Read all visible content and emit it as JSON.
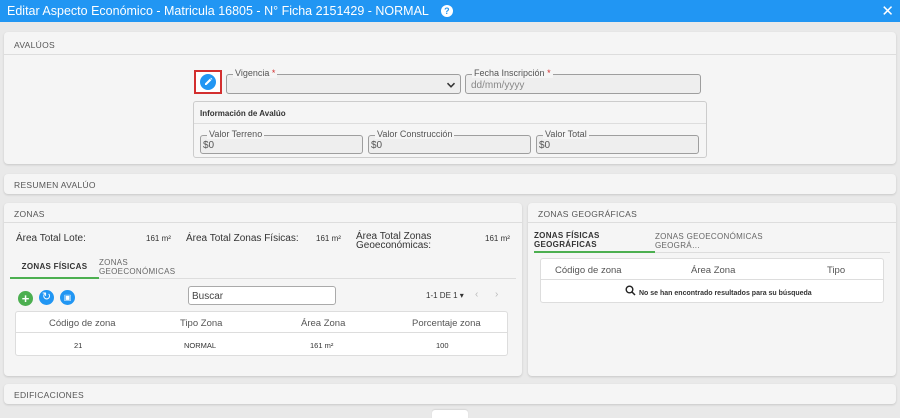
{
  "window": {
    "title": "Editar Aspecto Económico - Matricula 16805 - N° Ficha 2151429 - NORMAL",
    "help_icon": "question-circle-icon",
    "help_glyph": "?",
    "close_icon": "close-icon",
    "close_glyph": "✕"
  },
  "avaluos": {
    "section_title": "AVALÚOS",
    "edit_icon": "pencil-icon",
    "vigencia": {
      "label": "Vigencia",
      "required_mark": "*",
      "value": ""
    },
    "fecha_inscripcion": {
      "label": "Fecha Inscripción",
      "required_mark": "*",
      "placeholder": "dd/mm/yyyy"
    },
    "info": {
      "title": "Información de Avalúo",
      "valor_terreno": {
        "label": "Valor Terreno",
        "value": "$0"
      },
      "valor_construccion": {
        "label": "Valor Construcción",
        "value": "$0"
      },
      "valor_total": {
        "label": "Valor Total",
        "value": "$0"
      }
    }
  },
  "resumen": {
    "section_title": "RESUMEN AVALÚO"
  },
  "zonas": {
    "section_title": "ZONAS",
    "area_total_lote": {
      "label": "Área Total Lote:",
      "value": "161 m²"
    },
    "area_zonas_fisicas": {
      "label": "Área Total Zonas Físicas:",
      "value": "161 m²"
    },
    "area_zonas_geo": {
      "label_line1": "Área Total Zonas",
      "label_line2": "Geoeconómicas:",
      "value": "161 m²"
    },
    "tabs": [
      "ZONAS FÍSICAS",
      "ZONAS GEOECONÓMICAS"
    ],
    "add_glyph": "+",
    "refresh_glyph": "↻",
    "export_glyph": "▣",
    "search_placeholder": "Buscar",
    "pagination": "1-1 DE 1",
    "columns": [
      "Código de zona",
      "Tipo Zona",
      "Área Zona",
      "Porcentaje zona"
    ],
    "rows": [
      {
        "codigo": "21",
        "tipo": "NORMAL",
        "area": "161 m²",
        "porcentaje": "100"
      }
    ]
  },
  "zonas_geo": {
    "section_title": "ZONAS GEOGRÁFICAS",
    "tabs": [
      "ZONAS FÍSICAS GEOGRÁFICAS",
      "ZONAS GEOECONÓMICAS GEOGRÁ…"
    ],
    "columns": [
      "Código de zona",
      "Área Zona",
      "Tipo"
    ],
    "empty_message": "No se han encontrado resultados para su búsqueda"
  },
  "edificaciones": {
    "section_title": "EDIFICACIONES"
  },
  "colors": {
    "primary": "#2196f3",
    "success": "#4caf50",
    "danger": "#d32f2f"
  }
}
